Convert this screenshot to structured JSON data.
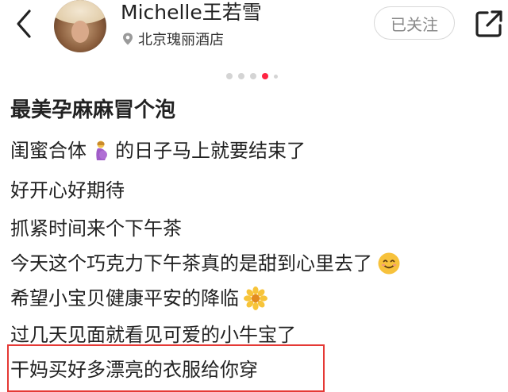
{
  "header": {
    "username": "Michelle王若雪",
    "location": "北京瑰丽酒店",
    "follow_label": "已关注"
  },
  "carousel": {
    "count": 5,
    "active_index": 3
  },
  "post": {
    "title": "最美孕麻麻冒个泡",
    "lines": [
      {
        "before": "闺蜜合体",
        "emoji": "pregnant-woman-emoji",
        "after": "的日子马上就要结束了"
      },
      {
        "text": "好开心好期待"
      },
      {
        "text": "抓紧时间来个下午茶"
      },
      {
        "text": "今天这个巧克力下午茶真的是甜到心里去了",
        "emoji": "smiling-face-emoji"
      },
      {
        "text": "希望小宝贝健康平安的降临",
        "emoji": "blossom-emoji"
      },
      {
        "text": "过几天见面就看见可爱的小牛宝了"
      },
      {
        "text": "干妈买好多漂亮的衣服给你穿"
      }
    ]
  },
  "colors": {
    "accent": "#ff2442",
    "highlight": "#e53935"
  }
}
